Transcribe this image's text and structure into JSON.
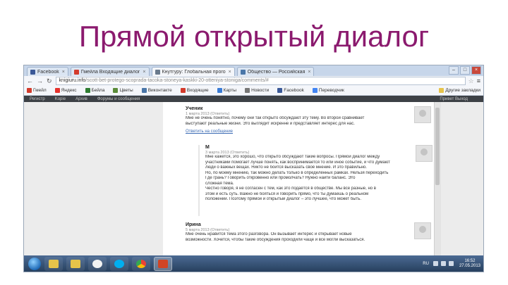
{
  "slide": {
    "title": "Прямой открытый диалог"
  },
  "browser": {
    "tabs": [
      {
        "label": "Facebook",
        "icon": "facebook-icon",
        "color": "#3b5998",
        "active": false
      },
      {
        "label": "Гмейла Входящие диалог",
        "icon": "gmail-icon",
        "color": "#d33b2c",
        "active": false
      },
      {
        "label": "Кнутгуру: Глобальная прого",
        "icon": "page-icon",
        "color": "#6a7a8c",
        "active": true
      },
      {
        "label": "Общество — Российская",
        "icon": "vk-icon",
        "color": "#4a76a8",
        "active": false
      }
    ],
    "url_main": "knigiuru.info",
    "url_rest": "/scott-bet-protego-scoprada-tacoka-stoneya-kaskki-20-otteniya-stoniga/comments/#",
    "bookmarks": [
      {
        "label": "Гмейл",
        "color": "#d33b2c"
      },
      {
        "label": "Яндекс",
        "color": "#e5322d"
      },
      {
        "label": "Бейла",
        "color": "#2f7d32"
      },
      {
        "label": "Цветы",
        "color": "#5b8c3a"
      },
      {
        "label": "Виконтакте",
        "color": "#4a76a8"
      },
      {
        "label": "Входящие",
        "color": "#d33b2c"
      },
      {
        "label": "Карты",
        "color": "#3a7bd5"
      },
      {
        "label": "Новости",
        "color": "#777777"
      },
      {
        "label": "Facebook",
        "color": "#3b5998"
      },
      {
        "label": "Переводчик",
        "color": "#4285f4"
      }
    ],
    "bookmarks_right": "Другие закладки",
    "page_nav": [
      "Регистр",
      "Kopiе",
      "Архив",
      "Форумы и сообщения"
    ],
    "page_nav_right": "Привет Выход"
  },
  "comments": [
    {
      "author": "Ученик",
      "meta": "1 марта 2013 (Ответить)",
      "reply_label": "Ответить на сообщение",
      "lines": [
        "Мне не очень понятно, почему они так открыто обсуждают эту тему. Во второй сравнивает",
        "выступают реальные жизни. Это выглядит искренне и представляет интерес для нас."
      ]
    },
    {
      "author": "М",
      "meta": "3 марта 2013 (Ответить)",
      "lines": [
        "Мне кажется, это хорошо, что открыто обсуждают такие вопросы. Прямой диалог между",
        "участниками помогает лучше понять, как воспринимается то или иное событие, и что думают",
        "люди о важных вещах. Никто не боится высказать своё мнение. И это правильно.",
        "Но, по моему мнению, так можно делать только в определённых рамках. Нельзя переходить",
        "Где грань? Говорить откровенно или промолчать? Нужно найти баланс. Это",
        "сложная тема.",
        "Честно говоря, я не согласен с тем, как это подаётся в обществе. Мы все разные, но в",
        "этом и есть суть. Важно не бояться и говорить прямо, что ты думаешь о реальном",
        "положении. Поэтому прямой и открытый диалог – это лучшее, что может быть."
      ]
    },
    {
      "author": "Ирина",
      "meta": "5 марта 2013 (Ответить)",
      "lines": [
        "Мне очень нравится тема этого разговора. Он вызывает интерес и открывает новые",
        "возможности. Хочется, чтобы такие обсуждения проходили чаще и все могли высказаться."
      ]
    }
  ],
  "taskbar": {
    "apps": [
      {
        "name": "explorer",
        "color": "#e6c34a",
        "active": false
      },
      {
        "name": "folder",
        "color": "#e6c34a",
        "active": false
      },
      {
        "name": "talk",
        "color": "#f2f2f2",
        "active": false
      },
      {
        "name": "skype",
        "color": "#00aff0",
        "active": false
      },
      {
        "name": "chrome",
        "color": "#34a853",
        "active": false
      },
      {
        "name": "powerpoint",
        "color": "#d04525",
        "active": true
      }
    ],
    "lang": "RU",
    "time": "16:52",
    "date": "27.05.2013"
  }
}
